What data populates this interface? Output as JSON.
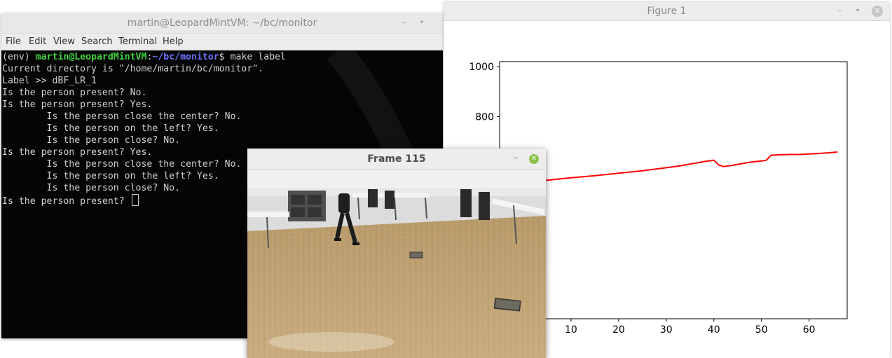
{
  "terminal": {
    "title": "martin@LeopardMintVM: ~/bc/monitor",
    "menu": [
      "File",
      "Edit",
      "View",
      "Search",
      "Terminal",
      "Help"
    ],
    "prompt_env": "(env) ",
    "prompt_user": "martin@LeopardMintVM",
    "prompt_sep": ":",
    "prompt_path": "~/bc/monitor",
    "prompt_end": "$ ",
    "command": "make label",
    "lines": [
      "Current directory is \"/home/martin/bc/monitor\".",
      "Label >> dBF_LR_1",
      "Is the person present? No.",
      "Is the person present? Yes.",
      "        Is the person close the center? No.",
      "        Is the person on the left? Yes.",
      "        Is the person close? No.",
      "Is the person present? Yes.",
      "        Is the person close the center? No.",
      "        Is the person on the left? Yes.",
      "        Is the person close? No.",
      "Is the person present? "
    ]
  },
  "figure": {
    "title": "Figure 1",
    "chart_data": {
      "type": "line",
      "color": "#ff0000",
      "x_ticks": [
        10,
        20,
        30,
        40,
        50,
        60
      ],
      "y_ticks": [
        800,
        1000
      ],
      "x_tick_labels": [
        "10",
        "20",
        "30",
        "40",
        "50",
        "60"
      ],
      "y_tick_labels": [
        "800",
        "1000"
      ],
      "xlim": [
        -5,
        68
      ],
      "ylim": [
        -10,
        1020
      ],
      "series": [
        {
          "x": [
            0,
            5,
            10,
            15,
            20,
            25,
            30,
            33,
            36,
            38,
            40,
            41,
            42,
            44,
            46,
            48,
            50,
            51,
            52,
            54,
            56,
            58,
            60,
            62,
            64,
            66
          ],
          "y": [
            535,
            545,
            555,
            563,
            573,
            583,
            595,
            603,
            613,
            620,
            625,
            607,
            600,
            605,
            612,
            618,
            622,
            625,
            645,
            647,
            648,
            648,
            650,
            652,
            655,
            658
          ]
        }
      ]
    }
  },
  "frame": {
    "title": "Frame 115",
    "minimize_icon": "minimize-icon",
    "close_icon": "close-icon"
  }
}
